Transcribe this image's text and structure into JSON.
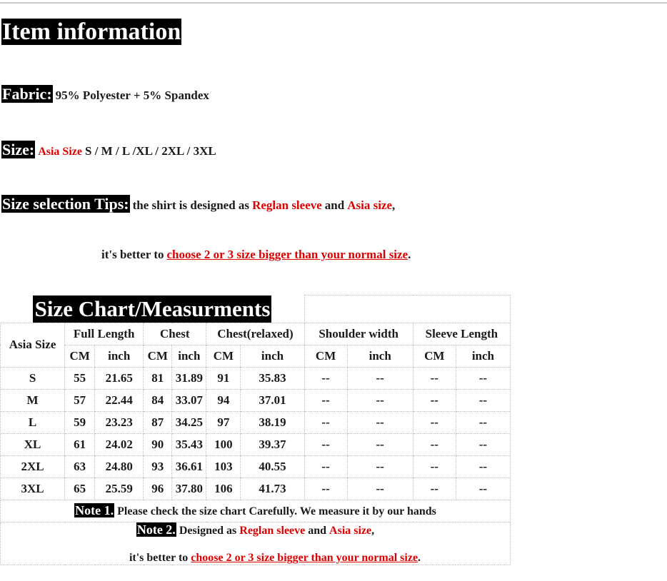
{
  "page": {
    "title": "Item information"
  },
  "fabric": {
    "label": "Fabric:",
    "value": "95% Polyester + 5% Spandex"
  },
  "size": {
    "label": "Size:",
    "region": "Asia Size",
    "list": "S / M / L /XL / 2XL / 3XL"
  },
  "tips": {
    "label": "Size selection Tips:",
    "text_1": "the shirt is designed as",
    "highlight_1": "Reglan sleeve",
    "text_2": "and",
    "highlight_2": "Asia size",
    "text_3": ",",
    "line2_prefix": "it's better to",
    "line2_link": "choose 2 or 3 size bigger than your normal size",
    "line2_suffix": "."
  },
  "chart": {
    "banner": "Size Chart/Measurments",
    "columns": [
      "Asia Size",
      "Full Length",
      "Chest",
      "Chest(relaxed)",
      "Shoulder width",
      "Sleeve Length"
    ],
    "unit_cm": "CM",
    "unit_inch": "inch",
    "rows": [
      {
        "size": "S",
        "full_length_cm": "55",
        "full_length_in": "21.65",
        "chest_cm": "81",
        "chest_in": "31.89",
        "chest_relaxed_cm": "91",
        "chest_relaxed_in": "35.83",
        "shoulder_cm": "--",
        "shoulder_in": "--",
        "sleeve_cm": "--",
        "sleeve_in": "--"
      },
      {
        "size": "M",
        "full_length_cm": "57",
        "full_length_in": "22.44",
        "chest_cm": "84",
        "chest_in": "33.07",
        "chest_relaxed_cm": "94",
        "chest_relaxed_in": "37.01",
        "shoulder_cm": "--",
        "shoulder_in": "--",
        "sleeve_cm": "--",
        "sleeve_in": "--"
      },
      {
        "size": "L",
        "full_length_cm": "59",
        "full_length_in": "23.23",
        "chest_cm": "87",
        "chest_in": "34.25",
        "chest_relaxed_cm": "97",
        "chest_relaxed_in": "38.19",
        "shoulder_cm": "--",
        "shoulder_in": "--",
        "sleeve_cm": "--",
        "sleeve_in": "--"
      },
      {
        "size": "XL",
        "full_length_cm": "61",
        "full_length_in": "24.02",
        "chest_cm": "90",
        "chest_in": "35.43",
        "chest_relaxed_cm": "100",
        "chest_relaxed_in": "39.37",
        "shoulder_cm": "--",
        "shoulder_in": "--",
        "sleeve_cm": "--",
        "sleeve_in": "--"
      },
      {
        "size": "2XL",
        "full_length_cm": "63",
        "full_length_in": "24.80",
        "chest_cm": "93",
        "chest_in": "36.61",
        "chest_relaxed_cm": "103",
        "chest_relaxed_in": "40.55",
        "shoulder_cm": "--",
        "shoulder_in": "--",
        "sleeve_cm": "--",
        "sleeve_in": "--"
      },
      {
        "size": "3XL",
        "full_length_cm": "65",
        "full_length_in": "25.59",
        "chest_cm": "96",
        "chest_in": "37.80",
        "chest_relaxed_cm": "106",
        "chest_relaxed_in": "41.73",
        "shoulder_cm": "--",
        "shoulder_in": "--",
        "sleeve_cm": "--",
        "sleeve_in": "--"
      }
    ]
  },
  "notes": {
    "note1_label": "Note 1.",
    "note1_text": "Please check the size chart Carefully. We measure it by our hands",
    "note2_label": "Note 2.",
    "note2_text_1": "Designed as",
    "note2_highlight_1": "Reglan sleeve",
    "note2_text_2": "and",
    "note2_highlight_2": "Asia size",
    "note2_text_3": ",",
    "note2_line2_prefix": "it's better to",
    "note2_line2_link": "choose 2 or 3 size bigger than your normal size",
    "note2_line2_suffix": "."
  },
  "colors": {
    "accent_red": "#dd0000",
    "chip_background": "#000000",
    "chip_text": "#ffffff",
    "grid_line": "#bdbdbd"
  },
  "chart_data": {
    "type": "table",
    "title": "Size Chart/Measurments",
    "columns": [
      "Asia Size",
      "Full Length CM",
      "Full Length inch",
      "Chest CM",
      "Chest inch",
      "Chest(relaxed) CM",
      "Chest(relaxed) inch",
      "Shoulder width CM",
      "Shoulder width inch",
      "Sleeve Length CM",
      "Sleeve Length inch"
    ],
    "rows": [
      [
        "S",
        55,
        21.65,
        81,
        31.89,
        91,
        35.83,
        "--",
        "--",
        "--",
        "--"
      ],
      [
        "M",
        57,
        22.44,
        84,
        33.07,
        94,
        37.01,
        "--",
        "--",
        "--",
        "--"
      ],
      [
        "L",
        59,
        23.23,
        87,
        34.25,
        97,
        38.19,
        "--",
        "--",
        "--",
        "--"
      ],
      [
        "XL",
        61,
        24.02,
        90,
        35.43,
        100,
        39.37,
        "--",
        "--",
        "--",
        "--"
      ],
      [
        "2XL",
        63,
        24.8,
        93,
        36.61,
        103,
        40.55,
        "--",
        "--",
        "--",
        "--"
      ],
      [
        "3XL",
        65,
        25.59,
        96,
        37.8,
        106,
        41.73,
        "--",
        "--",
        "--",
        "--"
      ]
    ]
  }
}
